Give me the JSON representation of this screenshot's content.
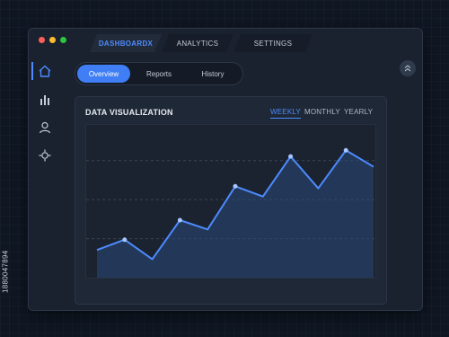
{
  "side_id": "1880047894",
  "window": {
    "controls": [
      {
        "name": "close",
        "color": "#ff5f57"
      },
      {
        "name": "minimize",
        "color": "#febc2e"
      },
      {
        "name": "maximize",
        "color": "#28c840"
      }
    ]
  },
  "tabs": [
    {
      "label": "DASHBOARDX",
      "active": true
    },
    {
      "label": "ANALYTICS",
      "active": false
    },
    {
      "label": "SETTINGS",
      "active": false
    }
  ],
  "sidebar": {
    "items": [
      {
        "icon": "home-icon",
        "active": true
      },
      {
        "icon": "bar-chart-icon",
        "active": false
      },
      {
        "icon": "user-icon",
        "active": false
      },
      {
        "icon": "location-icon",
        "active": false
      }
    ]
  },
  "subnav": [
    {
      "label": "Overview",
      "active": true
    },
    {
      "label": "Reports",
      "active": false
    },
    {
      "label": "History",
      "active": false
    }
  ],
  "profile_button": {
    "icon": "collapse-icon"
  },
  "panel": {
    "title": "DATA VISUALIZATION",
    "periods": [
      {
        "label": "WEEKLY",
        "active": true
      },
      {
        "label": "MONTHLY",
        "active": false
      },
      {
        "label": "YEARLY",
        "active": false
      }
    ]
  },
  "colors": {
    "accent": "#4d8bff",
    "line": "#4d8bff",
    "area": "#2a4a78"
  },
  "chart_data": {
    "type": "area",
    "x": [
      1,
      2,
      3,
      4,
      5,
      6,
      7,
      8,
      9,
      10,
      11
    ],
    "values": [
      27,
      37,
      18,
      56,
      47,
      89,
      79,
      118,
      87,
      124,
      108
    ],
    "markers": [
      false,
      true,
      false,
      true,
      false,
      true,
      false,
      true,
      false,
      true,
      false
    ],
    "ylim": [
      0,
      140
    ],
    "grid": true,
    "xlabel": "",
    "ylabel": "",
    "title": ""
  }
}
